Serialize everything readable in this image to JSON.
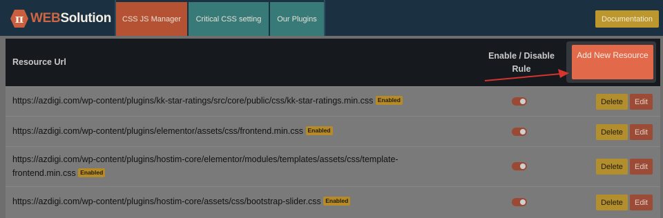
{
  "brand": {
    "prefix": "WEB",
    "suffix": "Solution"
  },
  "nav": {
    "tabs": [
      {
        "label": "CSS JS Manager",
        "active": true
      },
      {
        "label": "Critical CSS setting",
        "active": false
      },
      {
        "label": "Our Plugins",
        "active": false
      }
    ],
    "documentation_label": "Documentation"
  },
  "table": {
    "headers": {
      "url": "Resource Url",
      "rule": "Enable / Disable Rule"
    },
    "add_button_label": "Add New Resource",
    "rows": [
      {
        "url": "https://azdigi.com/wp-content/plugins/kk-star-ratings/src/core/public/css/kk-star-ratings.min.css",
        "status": "Enabled",
        "enabled": true
      },
      {
        "url": "https://azdigi.com/wp-content/plugins/elementor/assets/css/frontend.min.css",
        "status": "Enabled",
        "enabled": true
      },
      {
        "url_line1": "https://azdigi.com/wp-content/plugins/hostim-core/elementor/modules/templates/assets/css/template-",
        "url_line2": "frontend.min.css",
        "status": "Enabled",
        "enabled": true
      },
      {
        "url": "https://azdigi.com/wp-content/plugins/hostim-core/assets/css/bootstrap-slider.css",
        "status": "Enabled",
        "enabled": true
      }
    ],
    "delete_label": "Delete",
    "edit_label": "Edit"
  },
  "colors": {
    "accent": "#e26a4a",
    "nav_bg": "#1b3141",
    "teal": "#377a78",
    "gold": "#bc972e"
  }
}
